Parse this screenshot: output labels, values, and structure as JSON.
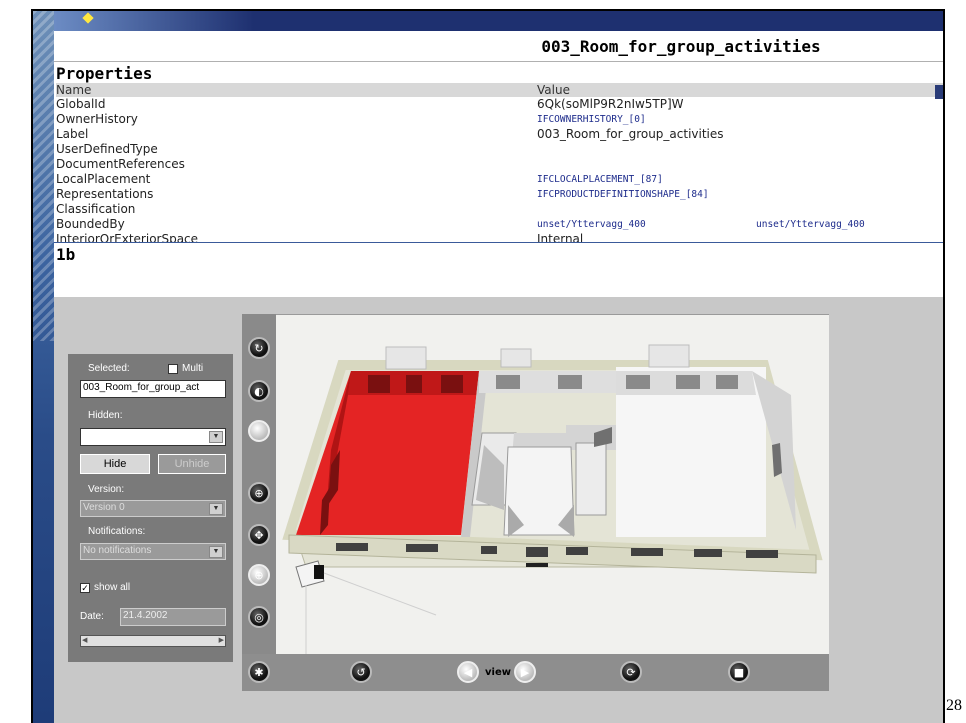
{
  "header": {
    "title": "003_Room_for_group_activities"
  },
  "properties": {
    "heading": "Properties",
    "col_name": "Name",
    "col_value": "Value",
    "rows": [
      {
        "name": "GlobalId",
        "value": "6Qk(soMlP9R2nIw5TP]W",
        "link": false
      },
      {
        "name": "OwnerHistory",
        "value": "IFCOWNERHISTORY_[0]",
        "link": true
      },
      {
        "name": "Label",
        "value": "003_Room_for_group_activities",
        "link": false
      },
      {
        "name": "UserDefinedType",
        "value": "",
        "link": false
      },
      {
        "name": "DocumentReferences",
        "value": "",
        "link": false
      },
      {
        "name": "LocalPlacement",
        "value": "IFCLOCALPLACEMENT_[87]",
        "link": true
      },
      {
        "name": "Representations",
        "value": "IFCPRODUCTDEFINITIONSHAPE_[84]",
        "link": true
      },
      {
        "name": "Classification",
        "value": "",
        "link": false
      },
      {
        "name": "BoundedBy",
        "value": "unset/Yttervagg_400",
        "value2": "unset/Yttervagg_400",
        "link": true
      },
      {
        "name": "InteriorOrExteriorSpace",
        "value": "Internal",
        "link": false
      }
    ]
  },
  "tag": "1b",
  "panel": {
    "selected_label": "Selected:",
    "multi_label": "Multi",
    "selected_value": "003_Room_for_group_act",
    "hidden_label": "Hidden:",
    "hidden_value": "",
    "hide_button": "Hide",
    "unhide_button": "Unhide",
    "version_label": "Version:",
    "version_value": "Version 0",
    "notifications_label": "Notifications:",
    "notifications_value": "No notifications",
    "show_all_label": "show all",
    "show_all_checked": true,
    "date_label": "Date:",
    "date_value": "21.4.2002"
  },
  "viewer": {
    "view_label": "view"
  },
  "page_number": "28",
  "colors": {
    "selected_room": "#e02020",
    "frame_blue": "#1e3070"
  }
}
